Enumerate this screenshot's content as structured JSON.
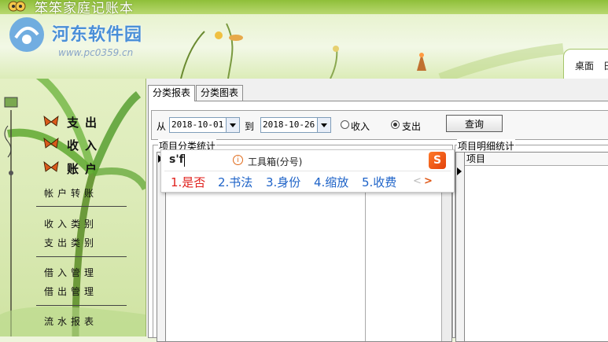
{
  "app": {
    "title": "笨笨家庭记账本"
  },
  "watermark": {
    "site": "河东软件园",
    "url": "www.pc0359.cn"
  },
  "header": {
    "desktop_tab": "桌面",
    "desktop_tab2": "日"
  },
  "sidebar": {
    "main_items": [
      {
        "label": "支出"
      },
      {
        "label": "收入"
      },
      {
        "label": "账户"
      }
    ],
    "groups": [
      [
        "帐户转账"
      ],
      [
        "收入类别",
        "支出类别"
      ],
      [
        "借入管理",
        "借出管理"
      ],
      [
        "流水报表"
      ]
    ]
  },
  "tabs": [
    {
      "label": "分类报表",
      "active": true
    },
    {
      "label": "分类图表",
      "active": false
    }
  ],
  "query": {
    "from_label": "从",
    "from_date": "2018-10-01",
    "to_label": "到",
    "to_date": "2018-10-26",
    "radio_income": "收入",
    "radio_expense": "支出",
    "selected": "支出",
    "search_button": "查询"
  },
  "panels": {
    "left_title": "项目分类统计",
    "right_title": "项目明细统计",
    "right_column": "项目"
  },
  "ime": {
    "composition": "s'f",
    "toolbox": "工具箱(分号)",
    "logo": "S",
    "candidates": [
      "1.是否",
      "2.书法",
      "3.身份",
      "4.缩放",
      "5.收费"
    ],
    "prev": "<",
    "next": ">"
  },
  "colors": {
    "accent_green": "#8fbf3a",
    "ime_candidate": "#1e63c8",
    "ime_first": "#e0201c"
  }
}
